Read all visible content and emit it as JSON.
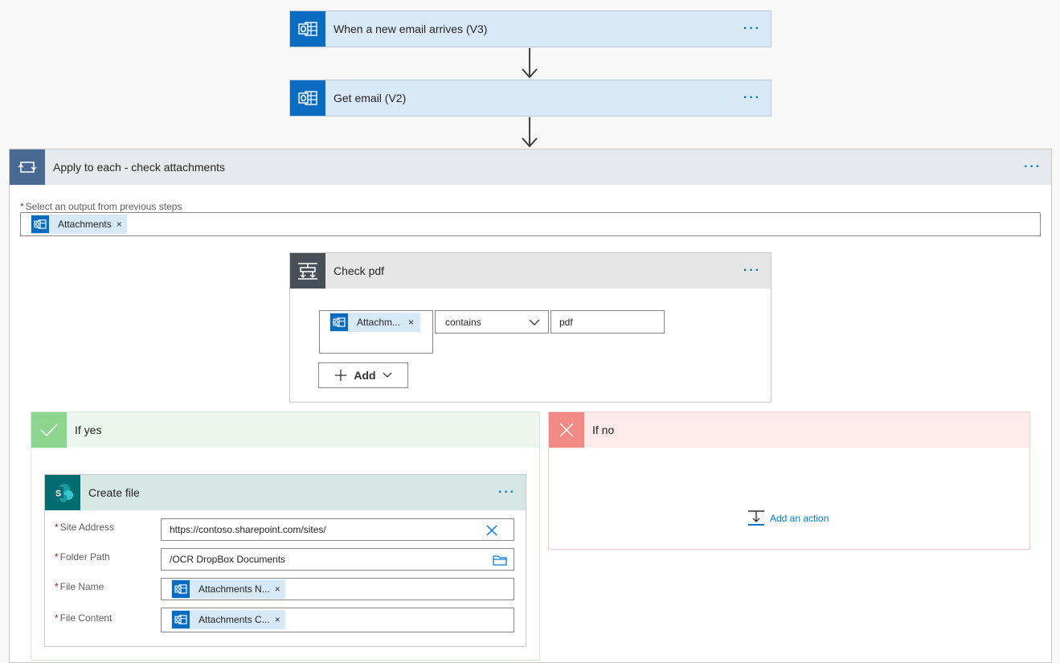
{
  "trigger": {
    "title": "When a new email arrives (V3)",
    "icon": "outlook-icon",
    "more": "···"
  },
  "get_email": {
    "title": "Get email (V2)",
    "icon": "outlook-icon",
    "more": "···"
  },
  "loop": {
    "title": "Apply to each - check attachments",
    "icon": "loop-icon",
    "more": "···",
    "field_required": "*",
    "field_label": "Select an output from previous steps",
    "token_label": "Attachments",
    "token_remove": "×"
  },
  "condition": {
    "title": "Check pdf",
    "icon": "condition-icon",
    "more": "···",
    "left_token": "Attachm...",
    "left_token_remove": "×",
    "operator": "contains",
    "value": "pdf",
    "add_label": "Add"
  },
  "if_yes": {
    "title": "If yes",
    "icon": "check-icon",
    "create_file": {
      "title": "Create file",
      "icon": "sharepoint-icon",
      "more": "···",
      "fields": [
        {
          "required": "*",
          "label": "Site Address",
          "value": "https://contoso.sharepoint.com/sites/"
        },
        {
          "required": "*",
          "label": "Folder Path",
          "value": "/OCR DropBox Documents"
        },
        {
          "required": "*",
          "label": "File Name",
          "token": "Attachments N...",
          "token_remove": "×"
        },
        {
          "required": "*",
          "label": "File Content",
          "token": "Attachments C...",
          "token_remove": "×"
        }
      ]
    }
  },
  "if_no": {
    "title": "If no",
    "icon": "close-icon",
    "add_action": "Add an action"
  },
  "colors": {
    "accent": "#0078d4",
    "outlook": "#0a6cc1",
    "loop": "#486991",
    "condition": "#484f58",
    "yes": "#8bd58f",
    "no": "#f28a85",
    "sharepoint": "#036c70",
    "required": "#a4262c"
  }
}
